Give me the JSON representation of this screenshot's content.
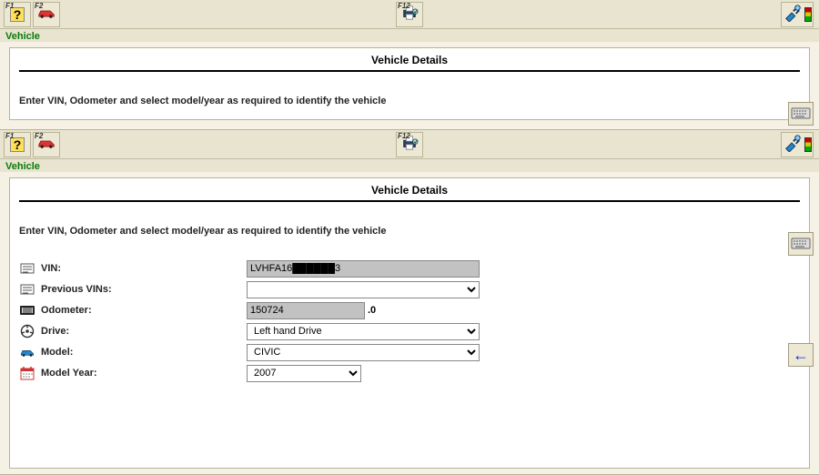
{
  "panel1": {
    "toolbar": {
      "f1": "F1",
      "f2": "F2",
      "f12": "F12"
    },
    "section": "Vehicle",
    "title": "Vehicle Details",
    "instruction": "Enter VIN, Odometer and select model/year as required to identify the vehicle"
  },
  "panel2": {
    "toolbar": {
      "f1": "F1",
      "f2": "F2",
      "f12": "F12"
    },
    "section": "Vehicle",
    "title": "Vehicle Details",
    "instruction": "Enter VIN, Odometer and select model/year as required to identify the vehicle",
    "form": {
      "vin": {
        "label": "VIN:",
        "value": "LVHFA16██████3"
      },
      "prevVins": {
        "label": "Previous VINs:",
        "value": ""
      },
      "odometer": {
        "label": "Odometer:",
        "value": "150724",
        "suffix": ".0"
      },
      "drive": {
        "label": "Drive:",
        "value": "Left hand Drive"
      },
      "model": {
        "label": "Model:",
        "value": "CIVIC"
      },
      "modelYear": {
        "label": "Model Year:",
        "value": "2007"
      }
    }
  }
}
